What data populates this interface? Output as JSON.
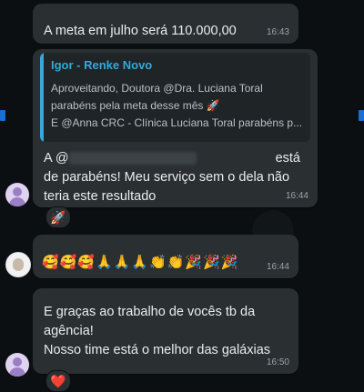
{
  "messages": [
    {
      "sender": "",
      "text": "A meta em julho será 110.000,00",
      "time": "16:43"
    },
    {
      "quote": {
        "author": "Igor - Renke Novo",
        "lines": [
          "Aproveitando, Doutora @Dra. Luciana Toral",
          "parabéns pela meta desse mês 🚀",
          "E @Anna CRC - Clínica Luciana Toral parabéns p..."
        ]
      },
      "text_start": "A @",
      "text_end_first_line": "está",
      "text_rest": [
        "de parabéns! Meu serviço sem o dela não",
        "teria este resultado"
      ],
      "time": "16:44",
      "reaction": "🚀"
    },
    {
      "sender": "",
      "emojis": "🥰🥰🥰🙏🙏🙏👏👏🎉🎉🎉",
      "time": "16:44"
    },
    {
      "lines": [
        "E graças ao trabalho de vocês tb da",
        "agência!",
        "Nosso time está o melhor das galáxias"
      ],
      "time": "16:50",
      "reaction": "❤️"
    }
  ]
}
